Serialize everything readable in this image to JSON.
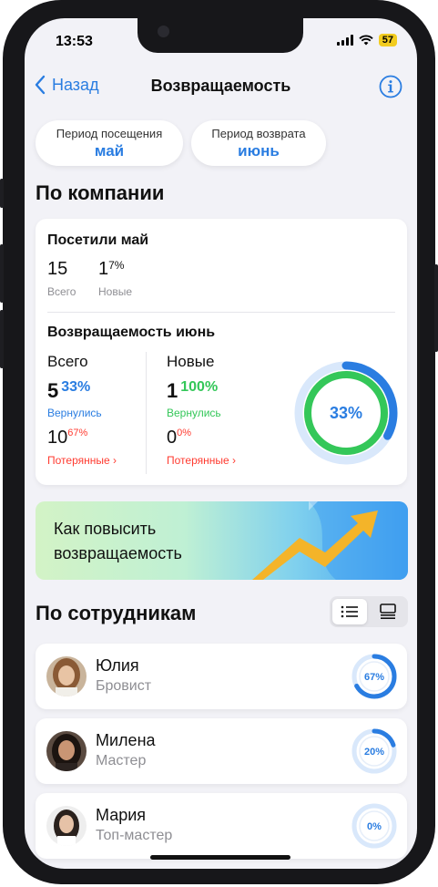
{
  "status": {
    "time": "13:53",
    "battery": "57"
  },
  "nav": {
    "back_label": "Назад",
    "title": "Возвращаемость"
  },
  "periods": {
    "visit": {
      "label": "Период посещения",
      "value": "май"
    },
    "return": {
      "label": "Период возврата",
      "value": "июнь"
    }
  },
  "company": {
    "section_title": "По компании",
    "visited_title": "Посетили май",
    "total_value": "15",
    "total_label": "Всего",
    "new_value": "1",
    "new_sup": "7%",
    "new_label": "Новые",
    "return_title": "Возвращаемость июнь",
    "all": {
      "header": "Всего",
      "returned_value": "5",
      "returned_pct": "33%",
      "returned_label": "Вернулись",
      "lost_value": "10",
      "lost_pct": "67%",
      "lost_label": "Потерянные"
    },
    "new": {
      "header": "Новые",
      "returned_value": "1",
      "returned_pct": "100%",
      "returned_label": "Вернулись",
      "lost_value": "0",
      "lost_pct": "0%",
      "lost_label": "Потерянные"
    },
    "ring": {
      "label": "33%",
      "outer_fraction": 0.33,
      "inner_fraction": 1.0
    }
  },
  "banner": {
    "line1": "Как повысить",
    "line2": "возвращаемость"
  },
  "employees": {
    "section_title": "По сотрудникам",
    "items": [
      {
        "name": "Юлия",
        "role": "Бровист",
        "pct": "67%",
        "fraction": 0.67
      },
      {
        "name": "Милена",
        "role": "Мастер",
        "pct": "20%",
        "fraction": 0.2
      },
      {
        "name": "Мария",
        "role": "Топ-мастер",
        "pct": "0%",
        "fraction": 0.0
      }
    ]
  },
  "colors": {
    "accent": "#2a7de1",
    "green": "#34c759",
    "red": "#ff3b30"
  }
}
